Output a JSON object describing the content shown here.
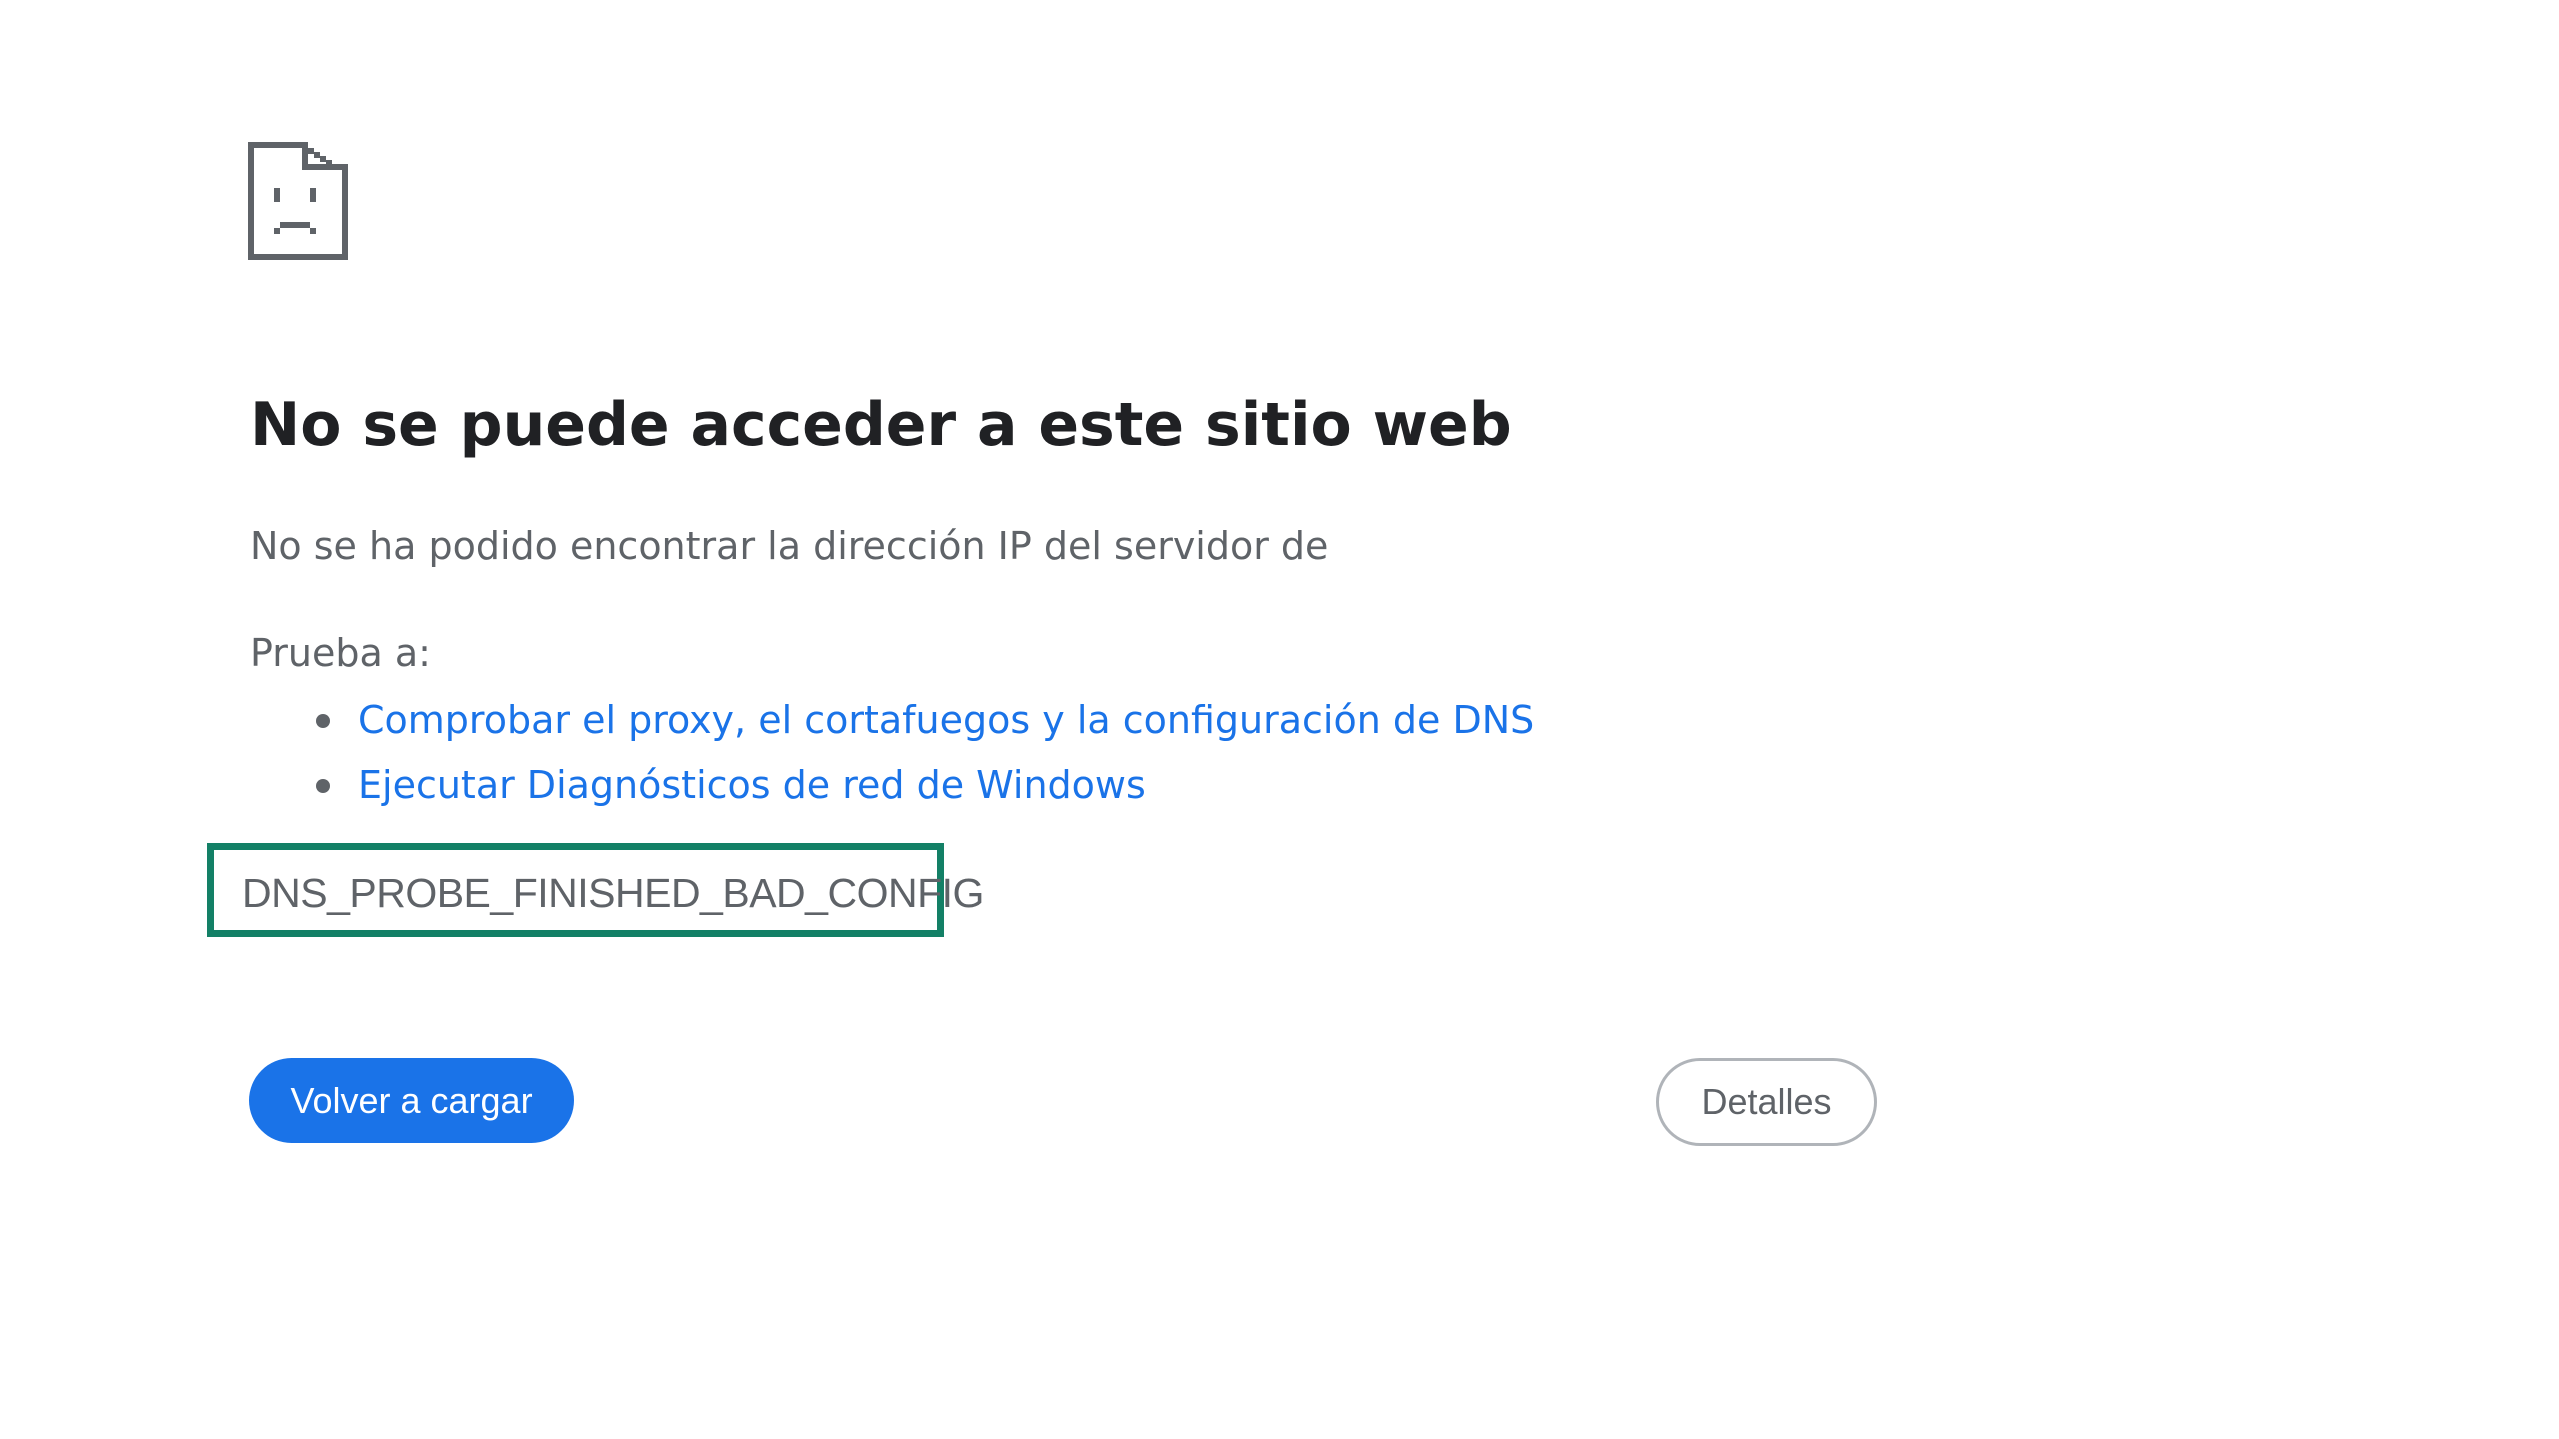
{
  "error_icon": "sad-page-icon",
  "title": "No se puede acceder a este sitio web",
  "description": "No se ha podido encontrar la dirección IP del servidor de",
  "suggestions": {
    "heading": "Prueba a:",
    "items": [
      {
        "label": "Comprobar el proxy, el cortafuegos y la configuración de DNS"
      },
      {
        "label": "Ejecutar Diagnósticos de red de Windows"
      }
    ]
  },
  "error_code": "DNS_PROBE_FINISHED_BAD_CONFIG",
  "buttons": {
    "reload_label": "Volver a cargar",
    "details_label": "Detalles"
  },
  "colors": {
    "link": "#1a73e8",
    "primary_button": "#1a73e8",
    "highlight_border": "#138066",
    "body_text": "#5f6368",
    "title_text": "#202124"
  }
}
